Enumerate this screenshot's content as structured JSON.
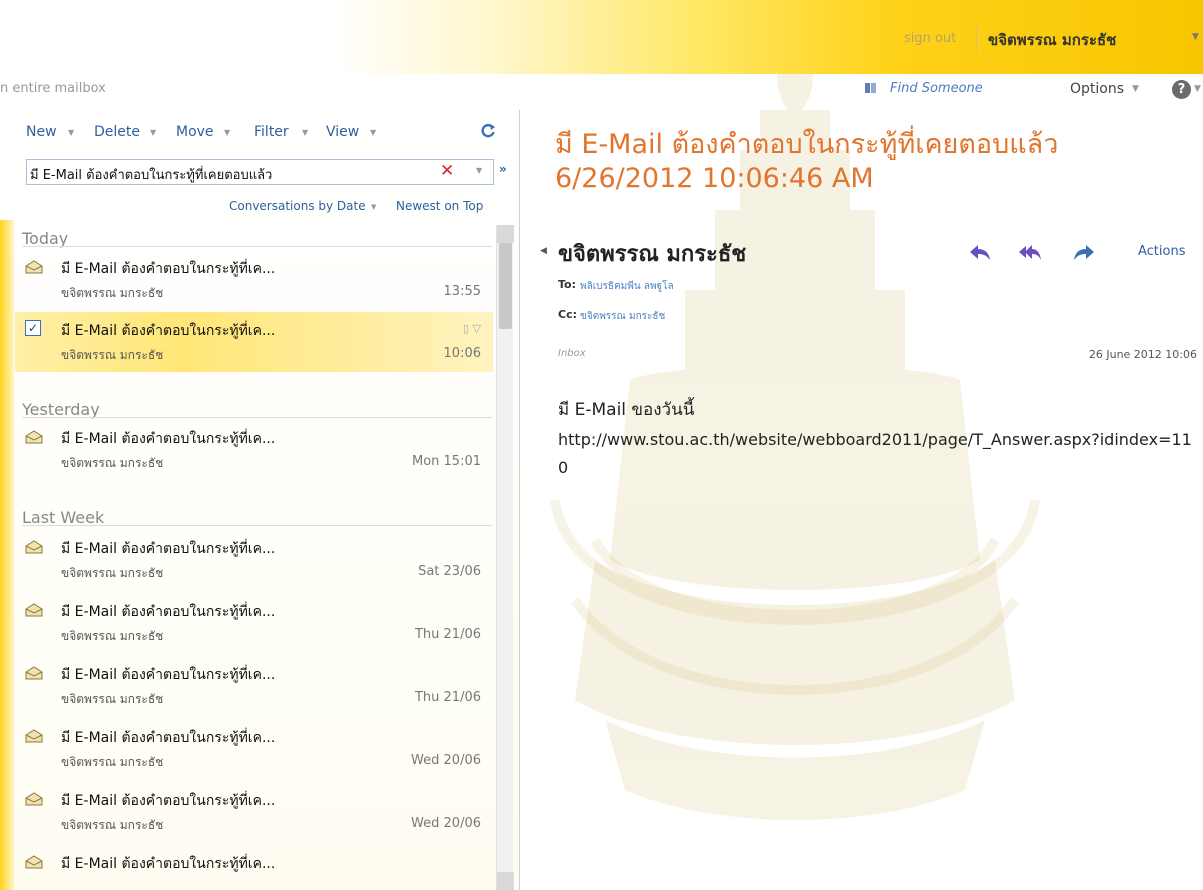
{
  "header": {
    "sign_out": "sign out",
    "user_name": "ขจิตพรรณ มกระธัช"
  },
  "search": {
    "scope_label": "n entire mailbox"
  },
  "nav": {
    "find_someone": "Find Someone",
    "options": "Options",
    "help": "?"
  },
  "toolbar": {
    "new": "New",
    "delete": "Delete",
    "move": "Move",
    "filter": "Filter",
    "view": "View"
  },
  "filter_box": {
    "value": "มี E-Mail ต้องคำตอบในกระทู้ที่เคยตอบแล้ว"
  },
  "sort": {
    "arrange_by": "Conversations by Date",
    "order": "Newest on Top"
  },
  "groups": {
    "today": "Today",
    "yesterday": "Yesterday",
    "last_week": "Last Week"
  },
  "messages": [
    {
      "subject": "มี E-Mail ต้องคำตอบในกระทู้ที่เค...",
      "from": "ขจิตพรรณ มกระธัช",
      "time": "13:55"
    },
    {
      "subject": "มี E-Mail ต้องคำตอบในกระทู้ที่เค...",
      "from": "ขจิตพรรณ มกระธัช",
      "time": "10:06"
    },
    {
      "subject": "มี E-Mail ต้องคำตอบในกระทู้ที่เค...",
      "from": "ขจิตพรรณ มกระธัช",
      "time": "Mon 15:01"
    },
    {
      "subject": "มี E-Mail ต้องคำตอบในกระทู้ที่เค...",
      "from": "ขจิตพรรณ มกระธัช",
      "time": "Sat 23/06"
    },
    {
      "subject": "มี E-Mail ต้องคำตอบในกระทู้ที่เค...",
      "from": "ขจิตพรรณ มกระธัช",
      "time": "Thu 21/06"
    },
    {
      "subject": "มี E-Mail ต้องคำตอบในกระทู้ที่เค...",
      "from": "ขจิตพรรณ มกระธัช",
      "time": "Thu 21/06"
    },
    {
      "subject": "มี E-Mail ต้องคำตอบในกระทู้ที่เค...",
      "from": "ขจิตพรรณ มกระธัช",
      "time": "Wed 20/06"
    },
    {
      "subject": "มี E-Mail ต้องคำตอบในกระทู้ที่เค...",
      "from": "ขจิตพรรณ มกระธัช",
      "time": "Wed 20/06"
    },
    {
      "subject": "มี E-Mail ต้องคำตอบในกระทู้ที่เค...",
      "from": "",
      "time": ""
    }
  ],
  "reading": {
    "title": "มี E-Mail ต้องคำตอบในกระทู้ที่เคยตอบแล้ว 6/26/2012 10:06:46 AM",
    "sender": "ขจิตพรรณ มกระธัช",
    "actions": "Actions",
    "to_label": "To:",
    "to_value": "พลิเบรธิคมพีน ลพฐูโล",
    "cc_label": "Cc:",
    "cc_value": "ขจิตพรรณ มกระธัช",
    "folder": "Inbox",
    "sent_time": "26 June 2012 10:06",
    "body_line1": "มี E-Mail ของวันนี้",
    "body_line2": "http://www.stou.ac.th/website/webboard2011/page/T_Answer.aspx?idindex=110"
  },
  "colors": {
    "accent_orange": "#e2752e",
    "link_blue": "#2f5f9e",
    "banner_yellow": "#ffd21a",
    "selected_row": "#ffe676",
    "clear_red": "#d8262b"
  }
}
